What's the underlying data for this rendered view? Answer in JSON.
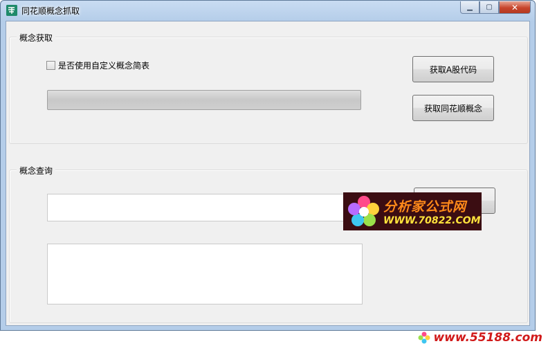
{
  "window": {
    "title": "同花顺概念抓取",
    "app_icon_glyph": "",
    "controls": {
      "minimize": "▁",
      "maximize": "▢",
      "close": "✕"
    }
  },
  "group_fetch": {
    "label": "概念获取",
    "checkbox_label": "是否使用自定义概念简表",
    "checkbox_checked": false,
    "progress_fraction": 0,
    "btn_get_a_share": "获取A股代码",
    "btn_get_concepts": "获取同花顺概念"
  },
  "group_query": {
    "label": "概念查询",
    "query_input_value": "",
    "query_button": "",
    "result_text": ""
  },
  "watermarks": {
    "site_name": "分析家公式网",
    "site_url": "WWW.70822.COM",
    "footer_url": "www.55188.com"
  },
  "colors": {
    "title_gradient": "#b4cde9",
    "client_bg": "#f0f0f0",
    "close_button": "#c7452c",
    "watermark_bg": "#3b0d12",
    "watermark_text1": "#ff8a1a",
    "watermark_text2": "#ffe23c",
    "footer_watermark": "#d11a1a"
  }
}
